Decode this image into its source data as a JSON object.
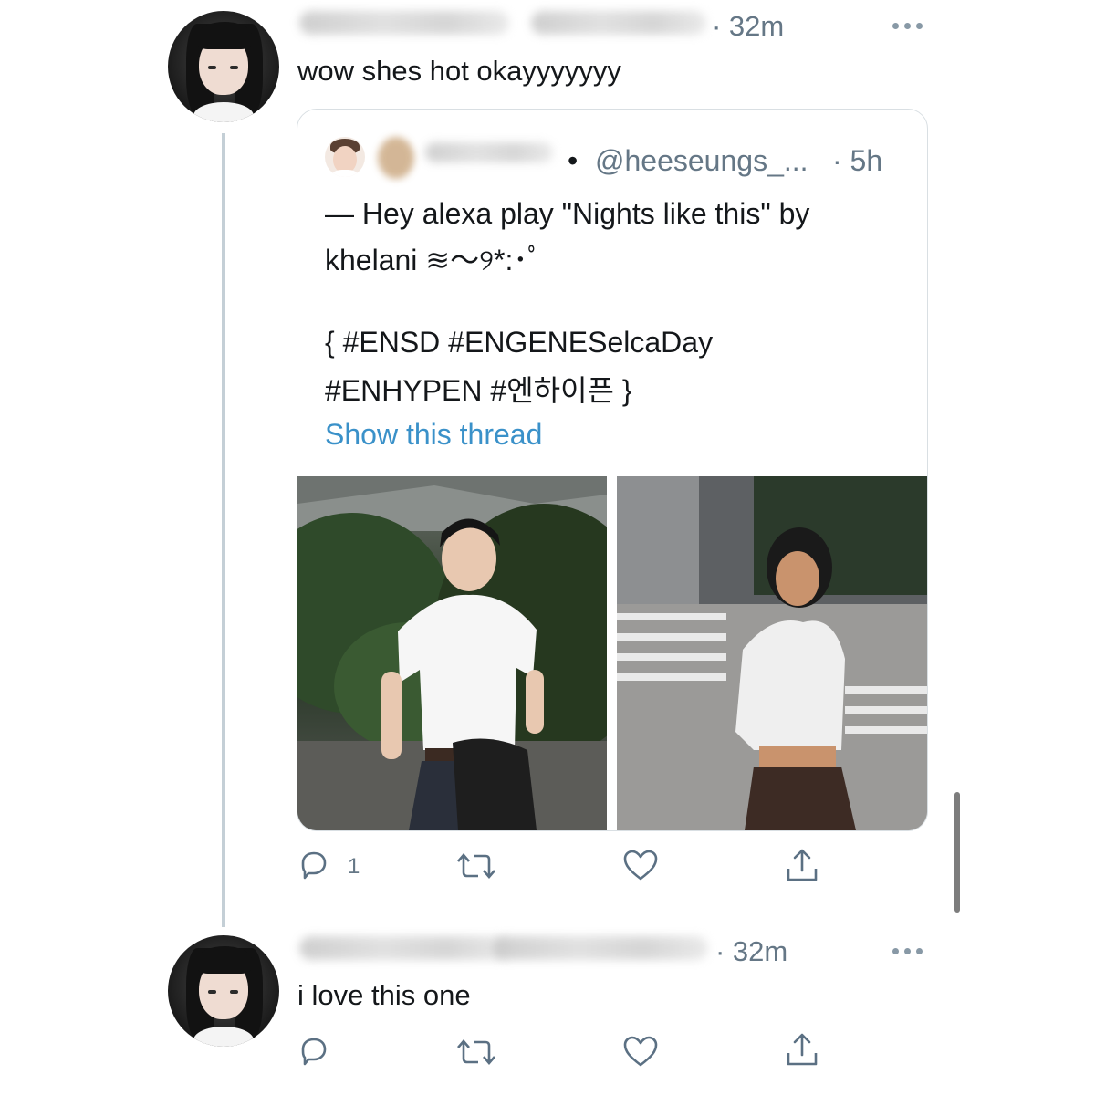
{
  "tweets": [
    {
      "time": "· 32m",
      "text": "wow shes hot okayyyyyyy",
      "avatar_icon": "user-avatar"
    },
    {
      "time": "· 32m",
      "text": "i love this one",
      "avatar_icon": "user-avatar"
    }
  ],
  "quote": {
    "separator": "•",
    "handle": "@heeseungs_...",
    "time": "· 5h",
    "line1": "— Hey alexa play \"Nights like this\" by",
    "line2": "khelani ≋～୨*:･ﾟ",
    "line3": "{ #ENSD #ENGENESelcaDay",
    "line4": "#ENHYPEN #엔하이픈 }",
    "show_thread": "Show this thread"
  },
  "actions_first": {
    "reply_count": "1"
  },
  "icons": {
    "reply": "reply-icon",
    "retweet": "retweet-icon",
    "like": "heart-icon",
    "share": "share-icon",
    "more": "more-icon"
  },
  "colors": {
    "link": "#3a91c9",
    "meta": "#657786",
    "icon": "#5b7083",
    "thread_line": "#c4cfd6"
  }
}
